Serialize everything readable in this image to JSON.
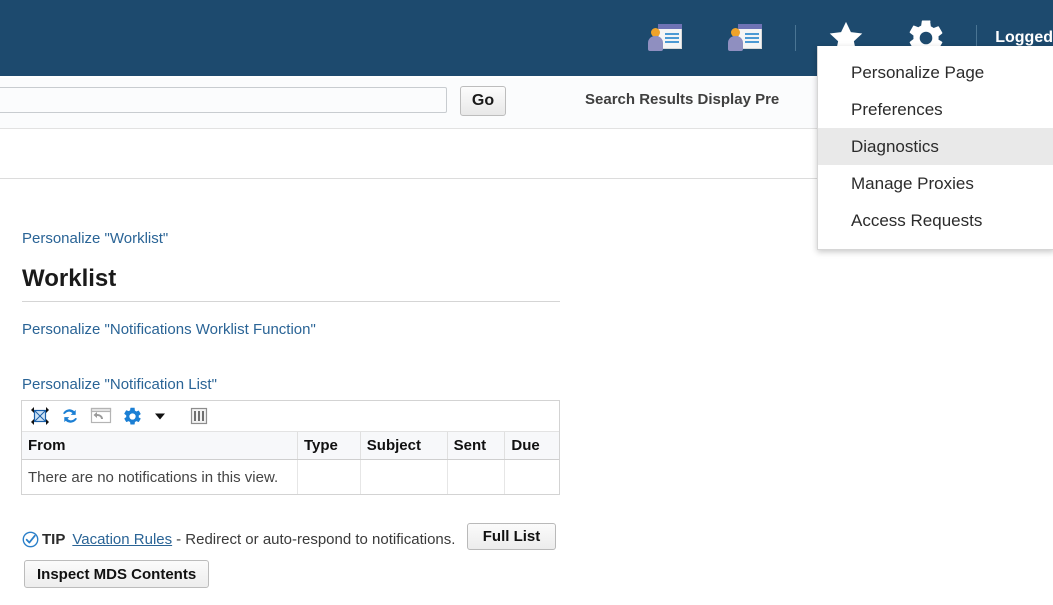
{
  "header": {
    "background_color": "#1d4a6e",
    "icons": [
      {
        "name": "worklist-person-doc-icon-1",
        "semantic": "person-document-icon"
      },
      {
        "name": "worklist-person-doc-icon-2",
        "semantic": "person-document-icon"
      },
      {
        "name": "favorites-star-icon",
        "semantic": "star-icon"
      },
      {
        "name": "settings-gear-icon",
        "semantic": "gear-icon"
      }
    ],
    "logged_label": "Logged"
  },
  "settings_menu": {
    "open": true,
    "highlighted": "Diagnostics",
    "items": [
      {
        "label": "Personalize Page"
      },
      {
        "label": "Preferences"
      },
      {
        "label": "Diagnostics"
      },
      {
        "label": "Manage Proxies"
      },
      {
        "label": "Access Requests"
      }
    ]
  },
  "search": {
    "value": "",
    "placeholder": "",
    "go_label": "Go",
    "results_display_pref_label": "Search Results Display Pre"
  },
  "worklist": {
    "personalize_worklist_link": "Personalize \"Worklist\"",
    "title": "Worklist",
    "personalize_function_link": "Personalize \"Notifications Worklist Function\"",
    "full_list_label": "Full List",
    "personalize_list_link": "Personalize \"Notification List\"",
    "toolbar_icons": [
      {
        "name": "detach-icon"
      },
      {
        "name": "refresh-icon"
      },
      {
        "name": "undo-icon"
      },
      {
        "name": "gear-icon"
      },
      {
        "name": "chevron-down-icon"
      },
      {
        "name": "columns-icon"
      }
    ],
    "table": {
      "columns": [
        "From",
        "Type",
        "Subject",
        "Sent",
        "Due"
      ],
      "empty_message": "There are no notifications in this view.",
      "rows": []
    }
  },
  "tip": {
    "badge": "TIP",
    "link": "Vacation Rules",
    "text": "- Redirect or auto-respond to notifications."
  },
  "footer": {
    "inspect_mds_label": "Inspect MDS Contents"
  },
  "colors": {
    "header_navy": "#1d4a6e",
    "link_blue": "#2a6496",
    "icon_blue": "#1b7fd4",
    "menu_highlight": "#e9e9e9"
  }
}
